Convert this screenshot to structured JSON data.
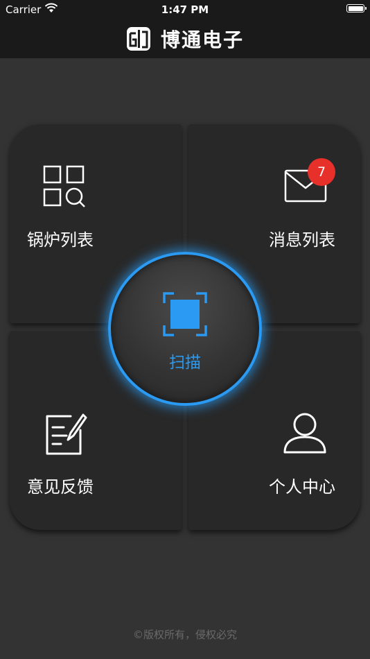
{
  "status_bar": {
    "carrier": "Carrier",
    "time": "1:47 PM",
    "icons": [
      "wifi-icon",
      "battery-icon"
    ]
  },
  "header": {
    "logo_icon": "boton-logo-icon",
    "title": "博通电子"
  },
  "tiles": {
    "boiler_list": {
      "label": "锅炉列表",
      "icon": "grid-search-icon"
    },
    "message_list": {
      "label": "消息列表",
      "icon": "envelope-icon",
      "badge": "7"
    },
    "feedback": {
      "label": "意见反馈",
      "icon": "edit-note-icon"
    },
    "profile": {
      "label": "个人中心",
      "icon": "user-icon"
    }
  },
  "scan": {
    "label": "扫描",
    "icon": "scan-icon"
  },
  "footer": {
    "copyright": "©版权所有，侵权必究"
  },
  "colors": {
    "background": "#333333",
    "bar": "#1a1a1a",
    "tile": "#282828",
    "accent": "#2a9af2",
    "badge": "#e8302a"
  }
}
